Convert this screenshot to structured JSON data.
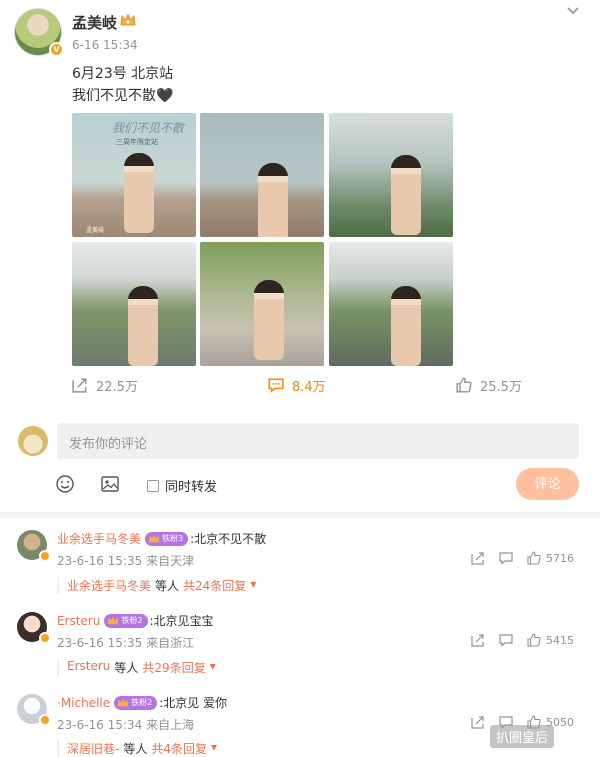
{
  "post": {
    "author": "孟美岐",
    "time": "6-16 15:34",
    "text_line1": "6月23号 北京站",
    "text_line2": "我们不见不散🖤",
    "poster_title": "我们不见不散",
    "poster_sub": "三周年限定站",
    "poster_mark": "孟美岐",
    "images": [
      "photo-1",
      "photo-2",
      "photo-3",
      "photo-4",
      "photo-5",
      "photo-6"
    ],
    "share_count": "22.5万",
    "comment_count": "8.4万",
    "like_count": "25.5万"
  },
  "composer": {
    "placeholder": "发布你的评论",
    "repost_label": "同时转发",
    "submit_label": "评论"
  },
  "comments": [
    {
      "name": "业余选手马冬美",
      "badge": "铁粉3",
      "text": ":北京不见不散",
      "time": "23-6-16 15:35",
      "location": "来自天津",
      "reply_name": "业余选手马冬美",
      "reply_mid": "等人",
      "reply_count": "共24条回复",
      "likes": "5716"
    },
    {
      "name": "Ersteru",
      "badge": "铁粉2",
      "text": ":北京见宝宝",
      "time": "23-6-16 15:35",
      "location": "来自浙江",
      "reply_name": "Ersteru",
      "reply_mid": "等人",
      "reply_count": "共29条回复",
      "likes": "5415"
    },
    {
      "name": "·Michelle",
      "badge": "铁粉2",
      "text": ":北京见 爱你",
      "time": "23-6-16 15:34",
      "location": "来自上海",
      "reply_name": "深居旧巷-",
      "reply_mid": "等人",
      "reply_count": "共4条回复",
      "likes": "5050"
    }
  ],
  "watermark": "扒圈皇后",
  "colors": {
    "accent_orange": "#ff8200",
    "name_orange": "#eb7350",
    "submit_bg": "#ffc09f",
    "badge_purple": "#b574e6"
  }
}
